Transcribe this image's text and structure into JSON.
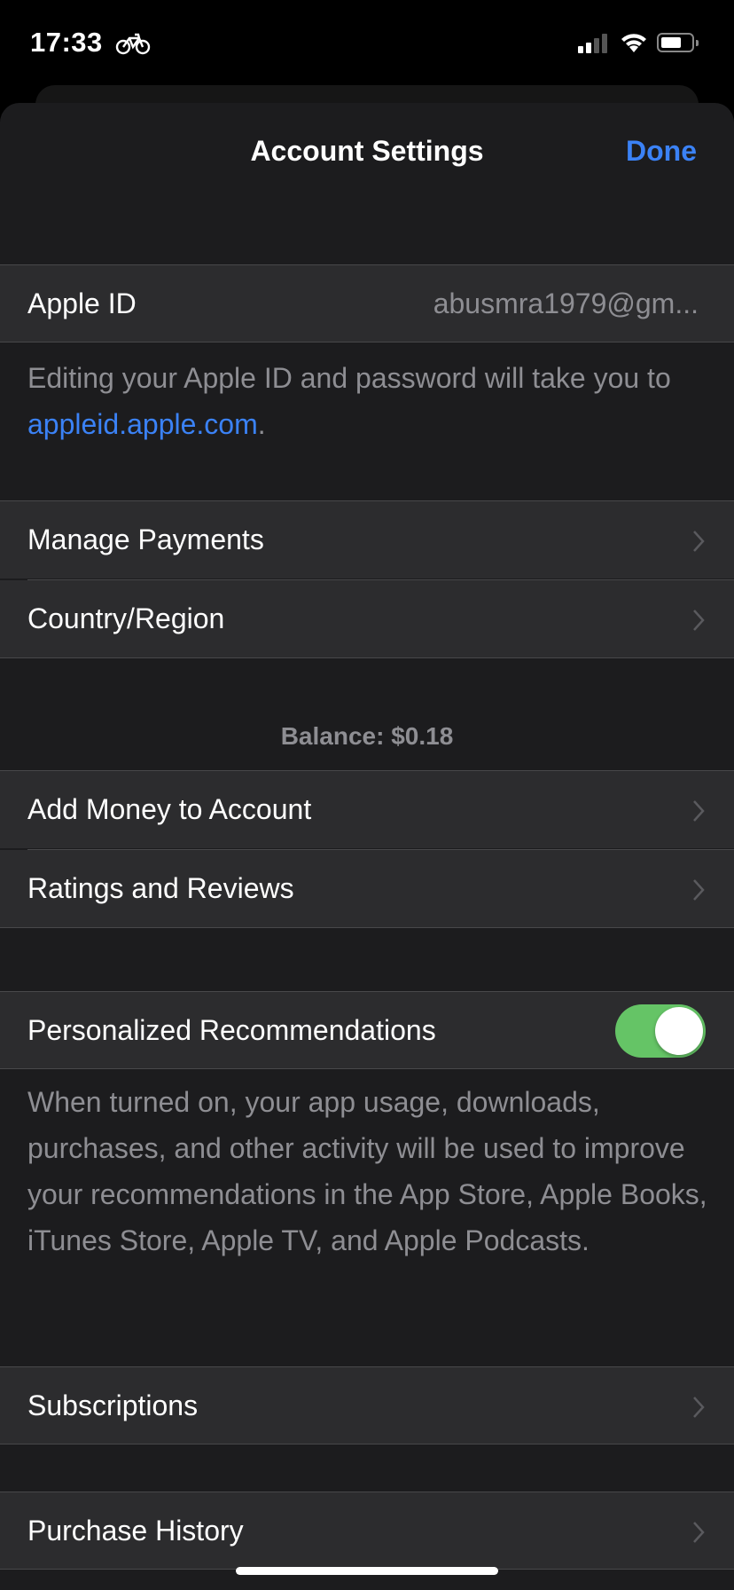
{
  "status_bar": {
    "time": "17:33",
    "activity_icon": "bicycle-icon",
    "signal_bars_active": 2,
    "signal_bars_total": 4,
    "wifi_icon": "wifi-icon",
    "battery_level_percent": 55
  },
  "header": {
    "title": "Account Settings",
    "done_label": "Done"
  },
  "apple_id": {
    "label": "Apple ID",
    "value": "abusmra1979@gm..."
  },
  "apple_id_footer": {
    "text_before": "Editing your Apple ID and password will take you to ",
    "link": "appleid.apple.com",
    "text_after": "."
  },
  "group1": [
    {
      "label": "Manage Payments"
    },
    {
      "label": "Country/Region"
    }
  ],
  "balance": "Balance: $0.18",
  "group2": [
    {
      "label": "Add Money to Account"
    },
    {
      "label": "Ratings and Reviews"
    }
  ],
  "personalized": {
    "label": "Personalized Recommendations",
    "enabled": true,
    "footer": "When turned on, your app usage, downloads, purchases, and other activity will be used to improve your recommendations in the App Store, Apple Books, iTunes Store, Apple TV, and Apple Podcasts."
  },
  "subscriptions": {
    "label": "Subscriptions"
  },
  "purchase_history": {
    "label": "Purchase History"
  },
  "colors": {
    "accent": "#3b82f6",
    "toggle_on": "#65c466",
    "background": "#1c1c1e",
    "cell": "#2c2c2e",
    "secondary_text": "#8e8e93"
  }
}
